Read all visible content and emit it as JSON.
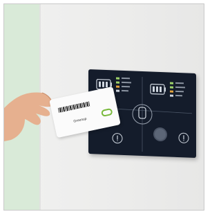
{
  "card": {
    "label": "Greenup"
  },
  "colors": {
    "panel": "#141c2b",
    "accent": "#78b93b",
    "wall_stripe": "#d9ead8"
  }
}
